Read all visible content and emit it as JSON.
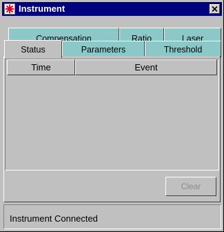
{
  "window": {
    "title": "Instrument",
    "close_glyph": "×"
  },
  "tabs_row_back": [
    {
      "label": "Compensation",
      "active": false
    },
    {
      "label": "Ratio",
      "active": false
    },
    {
      "label": "Laser",
      "active": false
    }
  ],
  "tabs_row_front": [
    {
      "label": "Status",
      "active": true
    },
    {
      "label": "Parameters",
      "active": false
    },
    {
      "label": "Threshold",
      "active": false
    }
  ],
  "table": {
    "columns": [
      "Time",
      "Event"
    ],
    "rows": []
  },
  "buttons": {
    "clear_label": "Clear",
    "clear_enabled": false
  },
  "status_bar": {
    "text": "Instrument Connected"
  },
  "colors": {
    "title_bar": "#000080",
    "tab_fill": "#8cc8c8",
    "window_face": "#c0c0c0",
    "icon_accent": "#e8001c"
  },
  "icons": {
    "app_icon": "asterisk-star-icon",
    "close": "close-icon"
  }
}
